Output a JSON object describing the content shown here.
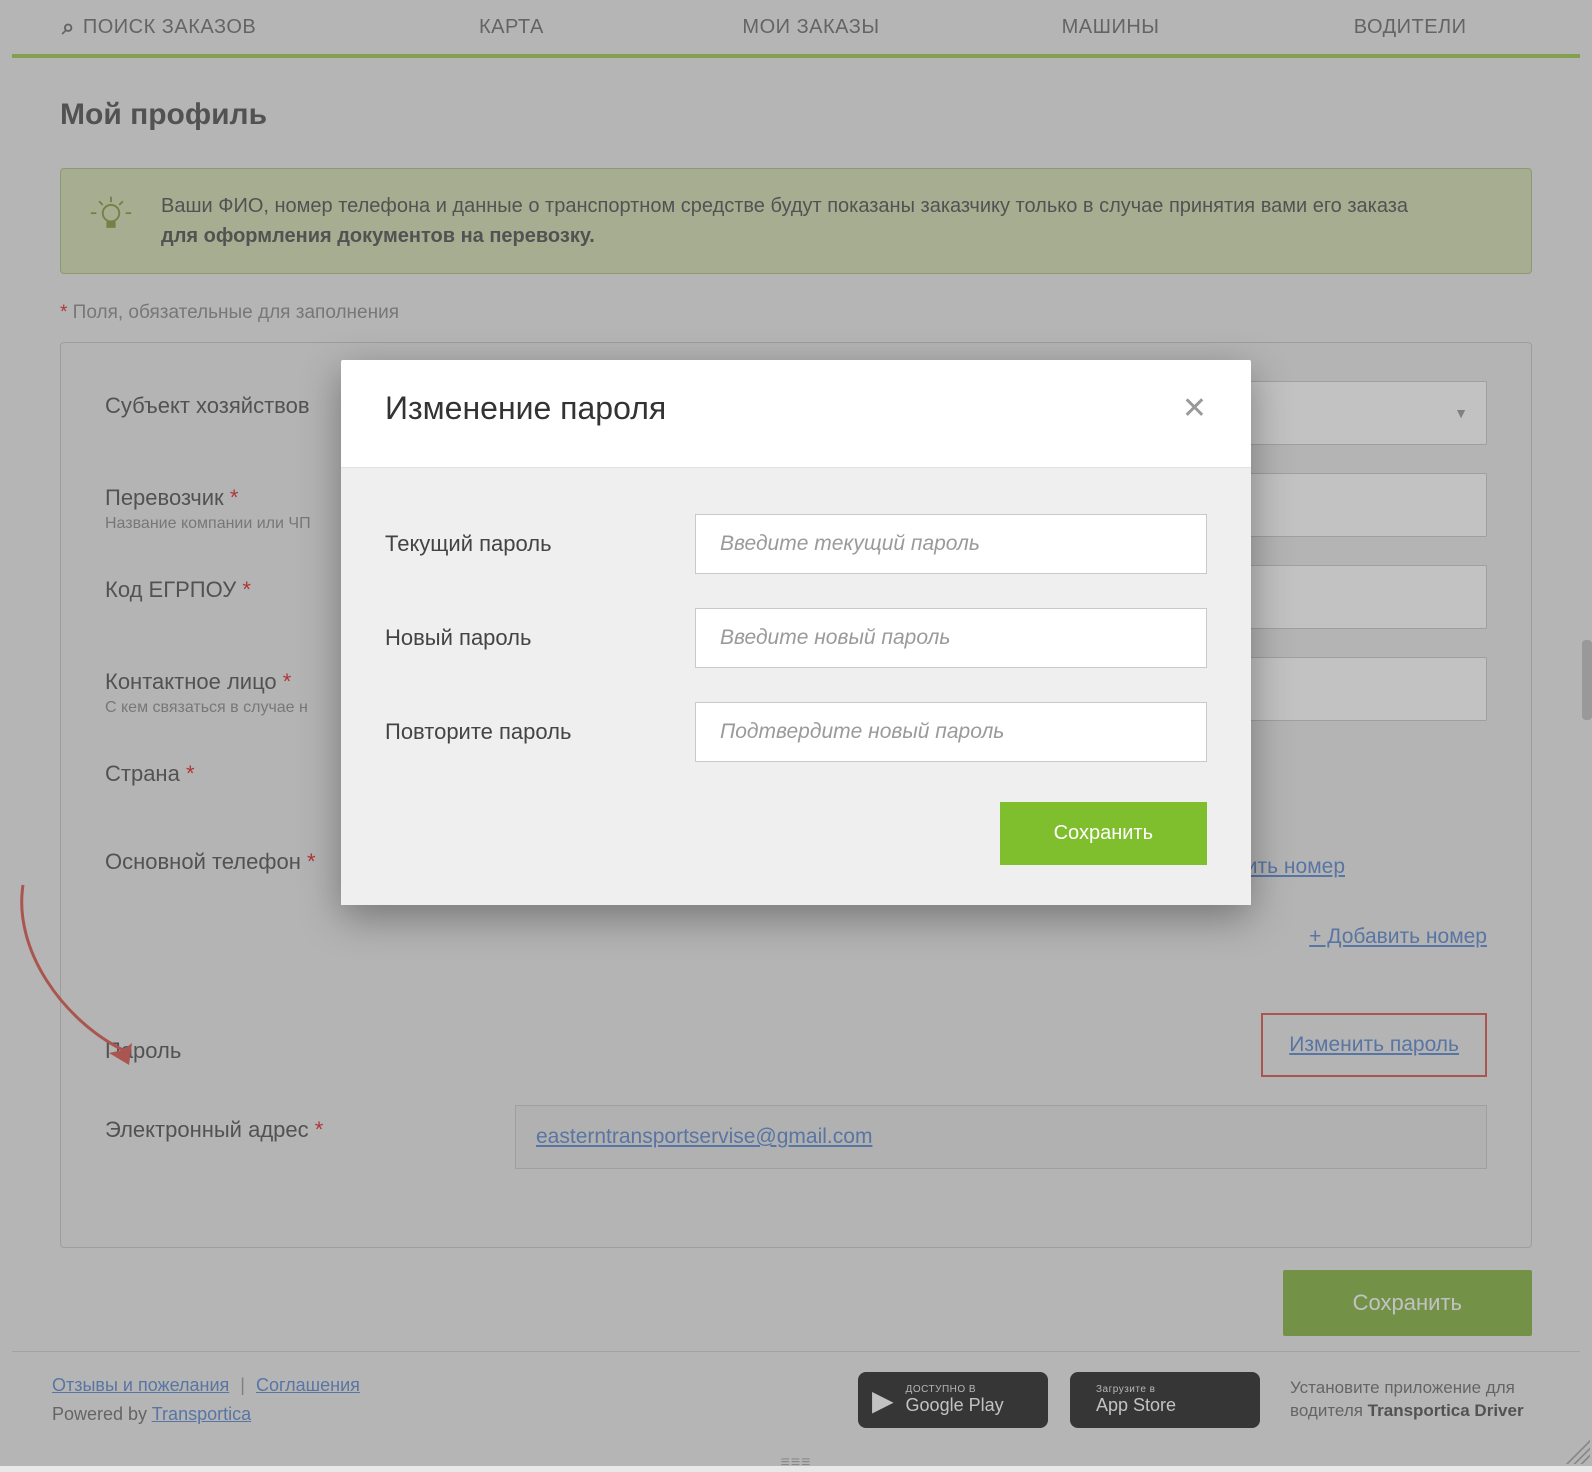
{
  "nav": {
    "search_orders": "ПОИСК ЗАКАЗОВ",
    "map": "КАРТА",
    "my_orders": "МОИ ЗАКАЗЫ",
    "vehicles": "МАШИНЫ",
    "drivers": "ВОДИТЕЛИ"
  },
  "page": {
    "title": "Мой профиль",
    "banner_line1": "Ваши ФИО, номер телефона и данные о транспортном средстве будут показаны заказчику только в случае принятия вами его заказа",
    "banner_line2": "для оформления документов на перевозку.",
    "required_note_prefix": "*",
    "required_note": " Поля, обязательные для заполнения"
  },
  "form": {
    "entity_label": "Субъект хозяйствов",
    "carrier_label": "Перевозчик",
    "carrier_sub": "Название компании или ЧП",
    "egrpou_label": "Код ЕГРПОУ",
    "contact_label": "Контактное лицо",
    "contact_sub": "С кем связаться в случае н",
    "country_label": "Страна",
    "phone_label": "Основной телефон",
    "change_number": "Изменить номер",
    "add_number": "+ Добавить номер",
    "password_label": "Пароль",
    "change_password": "Изменить пароль",
    "email_label": "Электронный адрес",
    "email_value": "easterntransportservise@gmail.com",
    "save_button": "Сохранить"
  },
  "modal": {
    "title": "Изменение пароля",
    "current_label": "Текущий пароль",
    "current_ph": "Введите текущий пароль",
    "new_label": "Новый пароль",
    "new_ph": "Введите новый пароль",
    "repeat_label": "Повторите пароль",
    "repeat_ph": "Подтвердите новый пароль",
    "save": "Сохранить"
  },
  "footer": {
    "feedback": "Отзывы и пожелания",
    "agreements": "Соглашения",
    "powered_by_prefix": "Powered by ",
    "powered_by_link": "Transportica",
    "gp_small": "ДОСТУПНО В",
    "gp_big": "Google Play",
    "as_small": "Загрузите в",
    "as_big": "App Store",
    "driver_note_1": "Установите приложение для водителя ",
    "driver_note_2": "Transportica Driver"
  }
}
